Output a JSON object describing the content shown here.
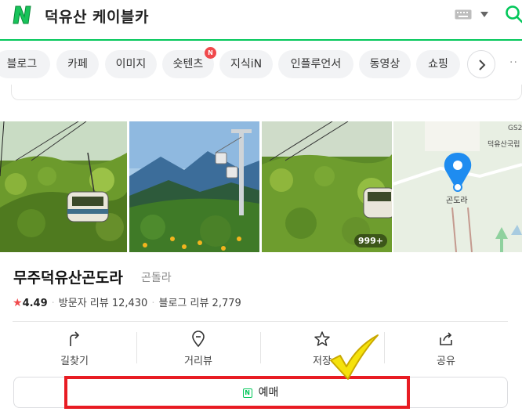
{
  "header": {
    "query": "덕유산 케이블카",
    "icons": [
      "naver-logo",
      "keyboard-icon",
      "caret-down-icon",
      "search-icon"
    ],
    "accent_color": "#03c75a"
  },
  "tabs": [
    {
      "label": "블로그"
    },
    {
      "label": "카페"
    },
    {
      "label": "이미지"
    },
    {
      "label": "숏텐츠",
      "badge": "N"
    },
    {
      "label": "지식iN"
    },
    {
      "label": "인플루언서"
    },
    {
      "label": "동영상"
    },
    {
      "label": "쇼핑"
    }
  ],
  "photos": {
    "count_badge": "999+",
    "map": {
      "pin_label": "곤도라",
      "poi_label": "덕유산국립",
      "gs_label": "GS2"
    }
  },
  "place": {
    "name": "무주덕유산곤도라",
    "category": "곤돌라",
    "rating": "4.49",
    "visitor_reviews": "방문자 리뷰 12,430",
    "blog_reviews": "블로그 리뷰 2,779"
  },
  "actions": [
    {
      "label": "길찾기",
      "icon": "directions-icon"
    },
    {
      "label": "거리뷰",
      "icon": "street-view-icon"
    },
    {
      "label": "저장",
      "icon": "star-icon"
    },
    {
      "label": "공유",
      "icon": "share-icon"
    }
  ],
  "reserve": {
    "label": "예매",
    "mini_logo": "N"
  },
  "annotation": {
    "highlight_color": "#e81c23",
    "check_color": "#f5e20c"
  }
}
